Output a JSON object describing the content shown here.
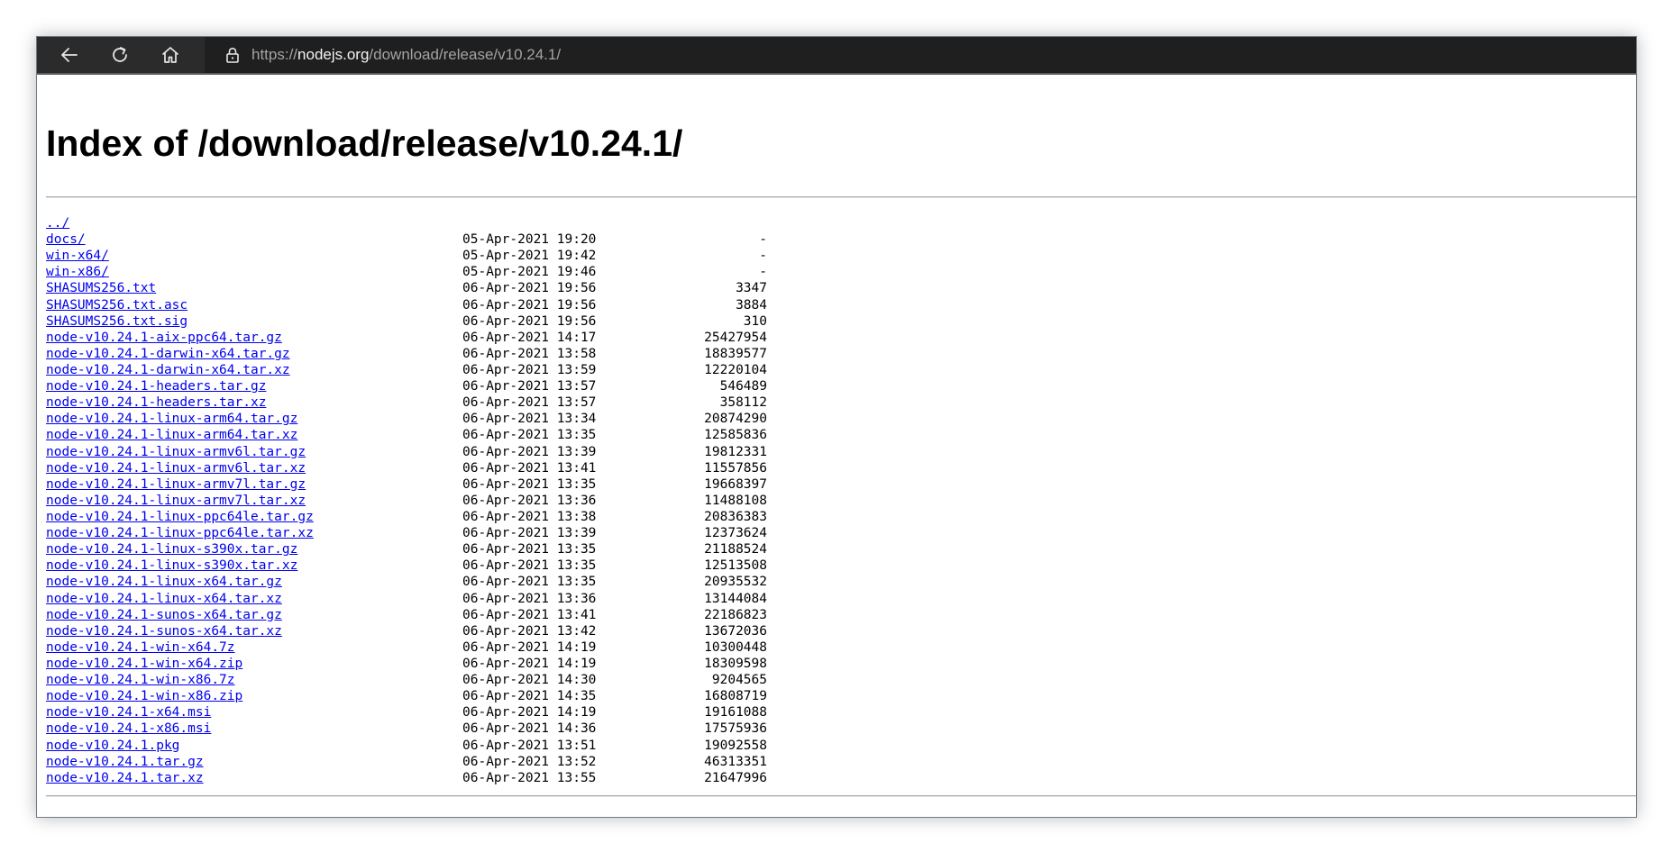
{
  "browser": {
    "url_scheme": "https://",
    "url_host": "nodejs.org",
    "url_path": "/download/release/v10.24.1/",
    "icons": {
      "back": "arrow-left-icon",
      "reload": "reload-icon",
      "home": "home-icon",
      "security": "lock-icon"
    }
  },
  "page": {
    "title": "Index of /download/release/v10.24.1/",
    "parent_link": "../"
  },
  "entries": [
    {
      "name": "docs/",
      "date": "05-Apr-2021 19:20",
      "size": "-"
    },
    {
      "name": "win-x64/",
      "date": "05-Apr-2021 19:42",
      "size": "-"
    },
    {
      "name": "win-x86/",
      "date": "05-Apr-2021 19:46",
      "size": "-"
    },
    {
      "name": "SHASUMS256.txt",
      "date": "06-Apr-2021 19:56",
      "size": "3347"
    },
    {
      "name": "SHASUMS256.txt.asc",
      "date": "06-Apr-2021 19:56",
      "size": "3884"
    },
    {
      "name": "SHASUMS256.txt.sig",
      "date": "06-Apr-2021 19:56",
      "size": "310"
    },
    {
      "name": "node-v10.24.1-aix-ppc64.tar.gz",
      "date": "06-Apr-2021 14:17",
      "size": "25427954"
    },
    {
      "name": "node-v10.24.1-darwin-x64.tar.gz",
      "date": "06-Apr-2021 13:58",
      "size": "18839577"
    },
    {
      "name": "node-v10.24.1-darwin-x64.tar.xz",
      "date": "06-Apr-2021 13:59",
      "size": "12220104"
    },
    {
      "name": "node-v10.24.1-headers.tar.gz",
      "date": "06-Apr-2021 13:57",
      "size": "546489"
    },
    {
      "name": "node-v10.24.1-headers.tar.xz",
      "date": "06-Apr-2021 13:57",
      "size": "358112"
    },
    {
      "name": "node-v10.24.1-linux-arm64.tar.gz",
      "date": "06-Apr-2021 13:34",
      "size": "20874290"
    },
    {
      "name": "node-v10.24.1-linux-arm64.tar.xz",
      "date": "06-Apr-2021 13:35",
      "size": "12585836"
    },
    {
      "name": "node-v10.24.1-linux-armv6l.tar.gz",
      "date": "06-Apr-2021 13:39",
      "size": "19812331"
    },
    {
      "name": "node-v10.24.1-linux-armv6l.tar.xz",
      "date": "06-Apr-2021 13:41",
      "size": "11557856"
    },
    {
      "name": "node-v10.24.1-linux-armv7l.tar.gz",
      "date": "06-Apr-2021 13:35",
      "size": "19668397"
    },
    {
      "name": "node-v10.24.1-linux-armv7l.tar.xz",
      "date": "06-Apr-2021 13:36",
      "size": "11488108"
    },
    {
      "name": "node-v10.24.1-linux-ppc64le.tar.gz",
      "date": "06-Apr-2021 13:38",
      "size": "20836383"
    },
    {
      "name": "node-v10.24.1-linux-ppc64le.tar.xz",
      "date": "06-Apr-2021 13:39",
      "size": "12373624"
    },
    {
      "name": "node-v10.24.1-linux-s390x.tar.gz",
      "date": "06-Apr-2021 13:35",
      "size": "21188524"
    },
    {
      "name": "node-v10.24.1-linux-s390x.tar.xz",
      "date": "06-Apr-2021 13:35",
      "size": "12513508"
    },
    {
      "name": "node-v10.24.1-linux-x64.tar.gz",
      "date": "06-Apr-2021 13:35",
      "size": "20935532"
    },
    {
      "name": "node-v10.24.1-linux-x64.tar.xz",
      "date": "06-Apr-2021 13:36",
      "size": "13144084"
    },
    {
      "name": "node-v10.24.1-sunos-x64.tar.gz",
      "date": "06-Apr-2021 13:41",
      "size": "22186823"
    },
    {
      "name": "node-v10.24.1-sunos-x64.tar.xz",
      "date": "06-Apr-2021 13:42",
      "size": "13672036"
    },
    {
      "name": "node-v10.24.1-win-x64.7z",
      "date": "06-Apr-2021 14:19",
      "size": "10300448"
    },
    {
      "name": "node-v10.24.1-win-x64.zip",
      "date": "06-Apr-2021 14:19",
      "size": "18309598"
    },
    {
      "name": "node-v10.24.1-win-x86.7z",
      "date": "06-Apr-2021 14:30",
      "size": "9204565"
    },
    {
      "name": "node-v10.24.1-win-x86.zip",
      "date": "06-Apr-2021 14:35",
      "size": "16808719"
    },
    {
      "name": "node-v10.24.1-x64.msi",
      "date": "06-Apr-2021 14:19",
      "size": "19161088"
    },
    {
      "name": "node-v10.24.1-x86.msi",
      "date": "06-Apr-2021 14:36",
      "size": "17575936"
    },
    {
      "name": "node-v10.24.1.pkg",
      "date": "06-Apr-2021 13:51",
      "size": "19092558"
    },
    {
      "name": "node-v10.24.1.tar.gz",
      "date": "06-Apr-2021 13:52",
      "size": "46313351"
    },
    {
      "name": "node-v10.24.1.tar.xz",
      "date": "06-Apr-2021 13:55",
      "size": "21647996"
    }
  ]
}
